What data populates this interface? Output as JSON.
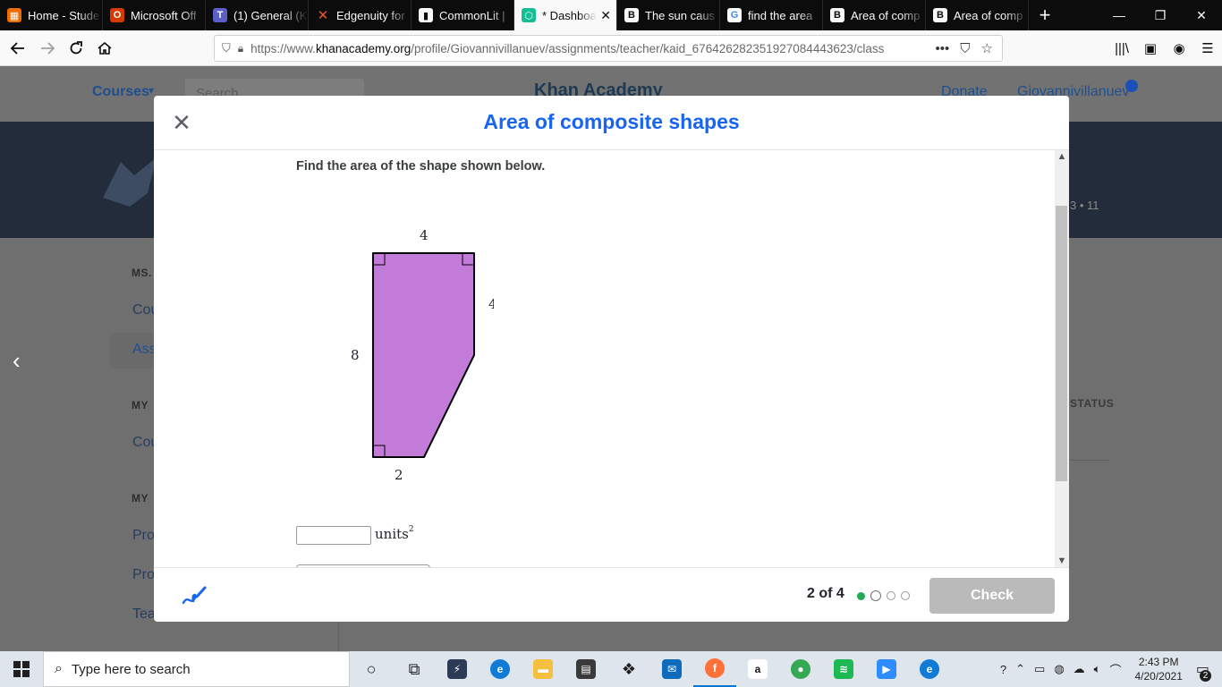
{
  "browser": {
    "tabs": [
      {
        "title": "Home - Stude",
        "icon": "office-icon",
        "color": "#eb6d00"
      },
      {
        "title": "Microsoft Off",
        "icon": "office-icon",
        "color": "#d83b01"
      },
      {
        "title": "(1) General (K",
        "icon": "teams-icon",
        "color": "#5b5fc7"
      },
      {
        "title": "Edgenuity for",
        "icon": "edgenuity-icon",
        "color": "#e8572f"
      },
      {
        "title": "CommonLit |",
        "icon": "book-icon",
        "color": "#0c0c0d"
      },
      {
        "title": "* Dashboa",
        "icon": "khan-academy-icon",
        "color": "#14bf96",
        "active": true
      },
      {
        "title": "The sun caus",
        "icon": "brainly-icon",
        "color": "#0c0c0d"
      },
      {
        "title": "find the area",
        "icon": "google-icon",
        "color": "#ffffff"
      },
      {
        "title": "Area of comp",
        "icon": "brainly-icon",
        "color": "#0c0c0d"
      },
      {
        "title": "Area of comp",
        "icon": "brainly-icon",
        "color": "#0c0c0d"
      }
    ],
    "url": {
      "prefix": "https://www.",
      "domain": "khanacademy.org",
      "path": "/profile/Giovannivillanuev/assignments/teacher/kaid_676426282351927084443623/class"
    }
  },
  "page": {
    "header": {
      "courses": "Courses",
      "search": "Search",
      "brand": "Khan Academy",
      "donate": "Donate",
      "user": "Giovannivillanuev"
    },
    "stats": "3 • 11",
    "sidebar": {
      "section1": "MS.",
      "item1": "Cou",
      "item2": "Ass",
      "section2": "MY",
      "item3": "Cou",
      "section3": "MY",
      "item4": "Pro",
      "item5": "Pro",
      "item6": "Tea"
    },
    "status_col": "STATUS"
  },
  "modal": {
    "title": "Area of composite shapes",
    "question": "Find the area of the shape shown below.",
    "shape_labels": {
      "top": "4",
      "right": "4",
      "left": "8",
      "bottom": "2"
    },
    "shape_fill": "#c27bd9",
    "answer": {
      "value": "",
      "units": "units",
      "exponent": "2"
    },
    "progress": {
      "text": "2 of 4",
      "current": 2,
      "total": 4
    },
    "check_label": "Check"
  },
  "taskbar": {
    "search_placeholder": "Type here to search",
    "time": "2:43 PM",
    "date": "4/20/2021",
    "notifications": "2"
  }
}
